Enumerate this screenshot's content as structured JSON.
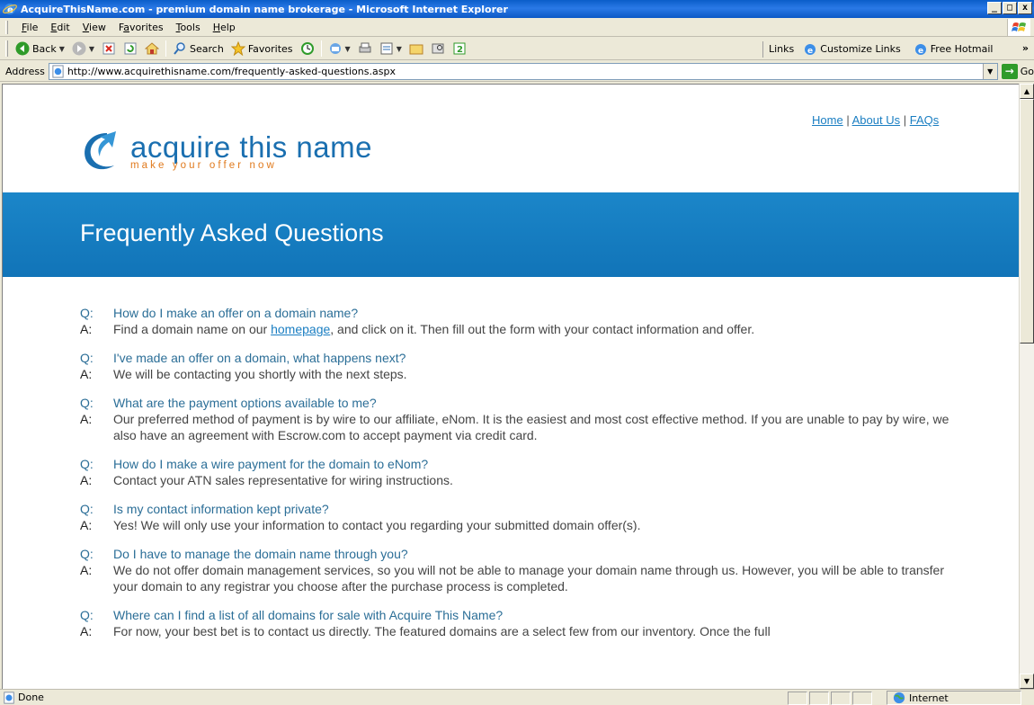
{
  "window": {
    "title": "AcquireThisName.com - premium domain name brokerage - Microsoft Internet Explorer",
    "minimize": "_",
    "maximize": "□",
    "close": "x"
  },
  "menu": {
    "items": [
      {
        "label": "File",
        "key": "F"
      },
      {
        "label": "Edit",
        "key": "E"
      },
      {
        "label": "View",
        "key": "V"
      },
      {
        "label": "Favorites",
        "key": "a"
      },
      {
        "label": "Tools",
        "key": "T"
      },
      {
        "label": "Help",
        "key": "H"
      }
    ]
  },
  "toolbar": {
    "back_label": "Back",
    "search_label": "Search",
    "favorites_label": "Favorites",
    "links_label": "Links",
    "customize_links_label": "Customize Links",
    "free_hotmail_label": "Free Hotmail",
    "more_label": "»"
  },
  "address": {
    "label": "Address",
    "url": "http://www.acquirethisname.com/frequently-asked-questions.aspx",
    "go_label": "Go"
  },
  "page": {
    "nav": {
      "home": "Home",
      "about": "About Us",
      "faqs": "FAQs",
      "separator": "|"
    },
    "logo": {
      "main": "acquire this name",
      "tagline": "make your offer now"
    },
    "banner_title": "Frequently Asked Questions",
    "q_label": "Q:",
    "a_label": "A:",
    "faqs": [
      {
        "q": "How do I make an offer on a domain name?",
        "a_pre": "Find a domain name on our ",
        "a_link": "homepage",
        "a_post": ", and click on it. Then fill out the form with your contact information and offer."
      },
      {
        "q": "I've made an offer on a domain, what happens next?",
        "a": "We will be contacting you shortly with the next steps."
      },
      {
        "q": "What are the payment options available to me?",
        "a": "Our preferred method of payment is by wire to our affiliate, eNom. It is the easiest and most cost effective method. If you are unable to pay by wire, we also have an agreement with Escrow.com to accept payment via credit card."
      },
      {
        "q": "How do I make a wire payment for the domain to eNom?",
        "a": "Contact your ATN sales representative for wiring instructions."
      },
      {
        "q": "Is my contact information kept private?",
        "a": "Yes! We will only use your information to contact you regarding your submitted domain offer(s)."
      },
      {
        "q": "Do I have to manage the domain name through you?",
        "a": "We do not offer domain management services, so you will not be able to manage your domain name through us. However, you will be able to transfer your domain to any registrar you choose after the purchase process is completed."
      },
      {
        "q": "Where can I find a list of all domains for sale with Acquire This Name?",
        "a": "For now, your best bet is to contact us directly. The featured domains are a select few from our inventory. Once the full"
      }
    ]
  },
  "status": {
    "text": "Done",
    "zone": "Internet"
  },
  "colors": {
    "banner": "#1a7ec2",
    "question": "#2b6e97",
    "link": "#1a7ec2",
    "logo_blue": "#1a6fb0",
    "logo_orange": "#e07a1d"
  }
}
